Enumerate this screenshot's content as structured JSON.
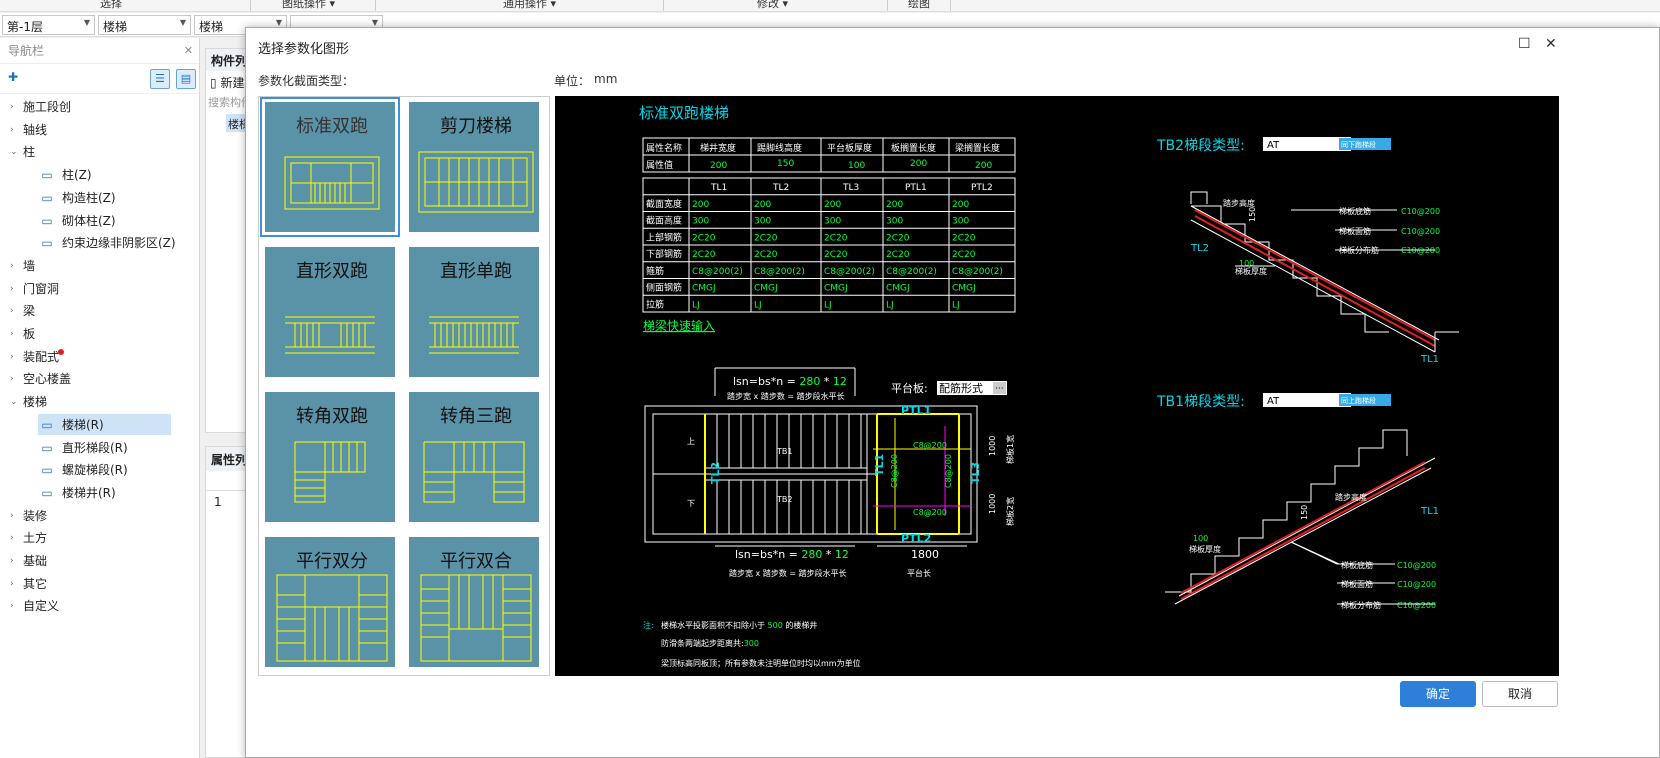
{
  "ribbon": {
    "items": [
      "选择",
      "图纸操作 ▾",
      "通用操作 ▾",
      "修改 ▾",
      "绘图"
    ]
  },
  "selectors": {
    "floor": "第-1层",
    "type": "楼梯",
    "subtype": "楼梯",
    "empty": ""
  },
  "nav": {
    "title": "导航栏",
    "items": [
      {
        "label": "施工段创",
        "arrow": "›"
      },
      {
        "label": "轴线",
        "arrow": "›"
      },
      {
        "label": "柱",
        "arrow": "⌄"
      },
      {
        "label": "柱(Z)",
        "sub": true,
        "icon": "column-icon"
      },
      {
        "label": "构造柱(Z)",
        "sub": true,
        "icon": "constructional-column-icon"
      },
      {
        "label": "砌体柱(Z)",
        "sub": true,
        "icon": "masonry-column-icon"
      },
      {
        "label": "约束边缘非阴影区(Z)",
        "sub": true,
        "icon": "boundary-zone-icon"
      },
      {
        "label": "墙",
        "arrow": "›"
      },
      {
        "label": "门窗洞",
        "arrow": "›"
      },
      {
        "label": "梁",
        "arrow": "›"
      },
      {
        "label": "板",
        "arrow": "›"
      },
      {
        "label": "装配式",
        "arrow": "›"
      },
      {
        "label": "空心楼盖",
        "arrow": "›"
      },
      {
        "label": "楼梯",
        "arrow": "⌄"
      },
      {
        "label": "楼梯(R)",
        "sub": true,
        "icon": "stair-icon"
      },
      {
        "label": "直形梯段(R)",
        "sub": true,
        "icon": "straight-flight-icon"
      },
      {
        "label": "螺旋梯段(R)",
        "sub": true,
        "icon": "spiral-flight-icon"
      },
      {
        "label": "楼梯井(R)",
        "sub": true,
        "icon": "stairwell-icon"
      },
      {
        "label": "装修",
        "arrow": "›"
      },
      {
        "label": "土方",
        "arrow": "›"
      },
      {
        "label": "基础",
        "arrow": "›"
      },
      {
        "label": "其它",
        "arrow": "›"
      },
      {
        "label": "自定义",
        "arrow": "›"
      }
    ]
  },
  "mid": {
    "component_list": "构件列",
    "new": "新建",
    "search": "搜索构件",
    "stair": "楼梯",
    "props": "属性列",
    "row1": "1"
  },
  "dialog": {
    "title": "选择参数化图形",
    "section_label": "参数化截面类型：",
    "unit_label": "单位：",
    "unit": "mm",
    "ok": "确定",
    "cancel": "取消",
    "cards": [
      "标准双跑",
      "剪刀楼梯",
      "直形双跑",
      "直形单跑",
      "转角双跑",
      "转角三跑",
      "平行双分",
      "平行双合"
    ]
  },
  "cad": {
    "title": "标准双跑楼梯",
    "t1_head": [
      "属性名称",
      "梯井宽度",
      "踢脚线高度",
      "平台板厚度",
      "板搁置长度",
      "梁搁置长度"
    ],
    "t1_vals": [
      "属性值",
      "200",
      "150",
      "100",
      "200",
      "200"
    ],
    "t2_head": [
      "",
      "TL1",
      "TL2",
      "TL3",
      "PTL1",
      "PTL2"
    ],
    "t2_rows": [
      [
        "截面宽度",
        "200",
        "200",
        "200",
        "200",
        "200"
      ],
      [
        "截面高度",
        "300",
        "300",
        "300",
        "300",
        "300"
      ],
      [
        "上部钢筋",
        "2C20",
        "2C20",
        "2C20",
        "2C20",
        "2C20"
      ],
      [
        "下部钢筋",
        "2C20",
        "2C20",
        "2C20",
        "2C20",
        "2C20"
      ],
      [
        "箍筋",
        "C8@200(2)",
        "C8@200(2)",
        "C8@200(2)",
        "C8@200(2)",
        "C8@200(2)"
      ],
      [
        "侧面钢筋",
        "CMGJ",
        "CMGJ",
        "CMGJ",
        "CMGJ",
        "CMGJ"
      ],
      [
        "拉筋",
        "LJ",
        "LJ",
        "LJ",
        "LJ",
        "LJ"
      ]
    ],
    "quick_input": "梯梁快速输入",
    "lsn_prefix": "lsn=bs*n =",
    "lsn_bs": "280",
    "lsn_star": "*",
    "lsn_n": "12",
    "lsn_desc": "踏步宽 x 踏步数 = 踏步段水平长",
    "platform_label": "平台板:",
    "platform_value": "配筋形式",
    "plan_labels": {
      "ptl1": "PTL1",
      "ptl2": "PTL2",
      "tl2": "TL2",
      "tl1": "TL1",
      "tl3": "TL3",
      "tb1": "TB1",
      "tb2": "TB2",
      "up": "上",
      "down": "下",
      "c1": "C8@200",
      "c2": "C8@200",
      "c3": "C8@200",
      "c4": "C8@200",
      "w1": "1000",
      "w2": "1000",
      "wl1": "梯板1宽",
      "wl2": "梯板2宽"
    },
    "platform_len": "1800",
    "platform_len_label": "平台长",
    "notes_prefix": "注:",
    "note1a": "楼梯水平投影面积不扣除小于",
    "note1b": "500",
    "note1c": "的楼梯井",
    "note2a": "防滑条两端起步距离共:",
    "note2b": "300",
    "note3": "梁顶标高同板顶；所有参数未注明单位时均以mm为单位",
    "tb2_label": "TB2梯段类型:",
    "tb2_value": "AT",
    "tb2_btn": "同下跑梯段",
    "tb1_label": "TB1梯段类型:",
    "tb1_value": "AT",
    "tb1_btn": "同上跑梯段",
    "sec": {
      "step_h": "踏步高度",
      "h150": "150",
      "slab_bottom": "梯板底筋",
      "slab_top": "梯板面筋",
      "slab_dist": "梯板分布筋",
      "c10": "C10@200",
      "thick": "梯板厚度",
      "t100": "100",
      "tl2": "TL2",
      "tl1": "TL1"
    }
  }
}
